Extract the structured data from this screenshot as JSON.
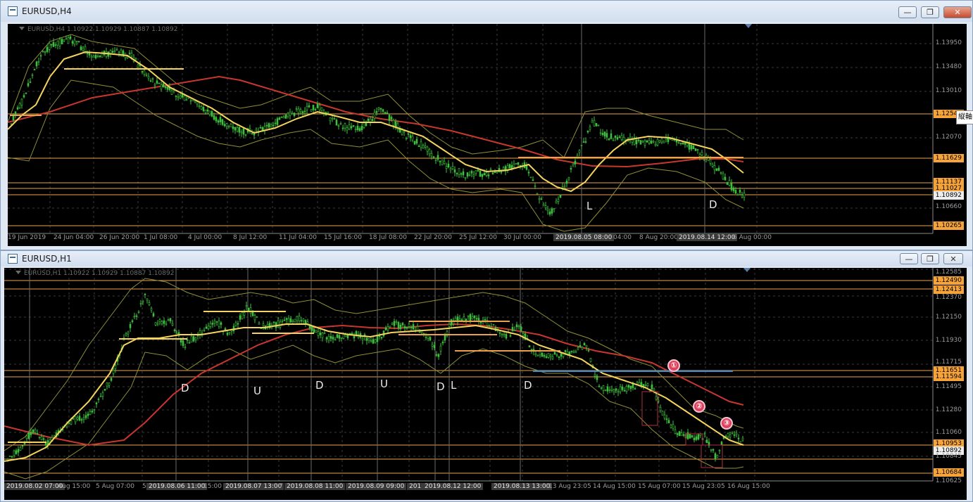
{
  "window_top": {
    "title": "EURUSD,H4",
    "info": "EURUSD,H4  1.10922 1.10929 1.10887 1.10892",
    "buttons": {
      "minimize": "—",
      "restore": "❐",
      "close": "✕"
    },
    "price_levels": [
      "1.13950",
      "1.13480",
      "1.13010",
      "1.12540",
      "1.12070",
      "1.11629",
      "1.11137",
      "1.11027",
      "1.10892",
      "1.10660",
      "1.10265"
    ],
    "time_labels": [
      "19 Jun 2019",
      "24 Jun 04:00",
      "26 Jun 20:00",
      "1 Jul 08:00",
      "4 Jul 00:00",
      "8 Jul 12:00",
      "11 Jul 04:00",
      "15 Jul 16:00",
      "18 Jul 08:00",
      "22 Jul 20:00",
      "25 Jul 12:00",
      "30 Jul 00:00",
      "2019.08.05 08:00",
      "04:00",
      "8 Aug 20:00",
      "2019.08.14 12:00",
      "6 Aug 00:00"
    ],
    "marks": [
      "L",
      "D"
    ],
    "tooltip": "縦軸"
  },
  "window_bottom": {
    "title": "EURUSD,H1",
    "info": "EURUSD,H1  1.10922 1.10929 1.10887 1.10892",
    "buttons": {
      "minimize": "—",
      "restore": "❐",
      "close": "✕"
    },
    "price_levels": [
      "1.12585",
      "1.12490",
      "1.12413",
      "1.12370",
      "1.12150",
      "1.11930",
      "1.11715",
      "1.11651",
      "1.11594",
      "1.11495",
      "1.11280",
      "1.11060",
      "1.10953",
      "1.10892",
      "1.10845",
      "1.10684",
      "1.10625"
    ],
    "time_labels": [
      "2019.08.02 07:00",
      "Aug 15:00",
      "5 Aug 07:00",
      "5",
      "2019.08.06 11:00",
      "15:00",
      "2019.08.07 13:00",
      "7",
      "2019.08.08 11:00",
      "2019.08.09 09:00",
      "201",
      "2019.08.12 12:00",
      "2019.08.13 13:00",
      "13 Aug 23:05",
      "14 Aug 15:00",
      "15 Aug 07:00",
      "15 Aug 23:05",
      "16 Aug 15:00"
    ],
    "marks": [
      "D",
      "U",
      "D",
      "U",
      "D",
      "L",
      "D"
    ],
    "badges": [
      "①",
      "②",
      "③"
    ]
  },
  "colors": {
    "price_tag": "#f6a43a",
    "ma_fast": "#f4d35e",
    "ma_slow": "#c8372d",
    "candle": "#3fbf3f",
    "band": "#8f8f38",
    "hline": "#e9a24b",
    "blue_line": "#3b8ed6"
  }
}
